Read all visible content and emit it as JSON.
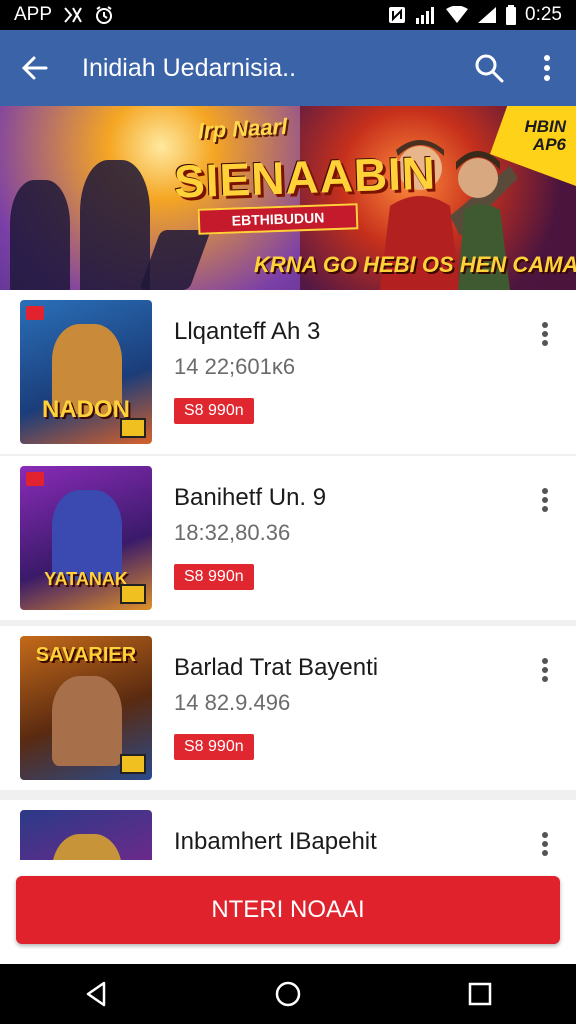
{
  "status_bar": {
    "app_label": "APP",
    "time": "0:25",
    "icons": [
      "network-icon",
      "alarm-icon",
      "nfc-icon",
      "signal-icon",
      "wifi-icon",
      "signal-icon",
      "battery-icon"
    ]
  },
  "app_bar": {
    "title": "Inidiah Uedarnisia..",
    "icons": [
      "back-arrow-icon",
      "search-icon",
      "more-vert-icon"
    ]
  },
  "banner": {
    "top_tag": "Irp Naarl",
    "main_title": "SIENAABIN",
    "ribbon": "EBTHIBUDUN",
    "bottom_line": "KRNA GO HEBI OS HEN CAMAA.",
    "badge_line1": "HBIN",
    "badge_line2": "AP6"
  },
  "list": {
    "items": [
      {
        "title": "Llqanteff Ah 3",
        "subtitle": "14 22;601κ6",
        "price": "S8 990n",
        "thumb_label": "NADON"
      },
      {
        "title": "Banihetf Un. 9",
        "subtitle": "18:32,80.36",
        "price": "S8 990n",
        "thumb_label": "YATANAK"
      },
      {
        "title": "Barlad Trat Bayenti",
        "subtitle": "14 82.9.496",
        "price": "S8 990n",
        "thumb_label": "SAVARIER"
      },
      {
        "title": "Inbamhert IBapehit",
        "subtitle": "",
        "price": "",
        "thumb_label": ""
      }
    ],
    "colors": {
      "price_chip": "#e0262f",
      "thumb_1": "#2a6fb8",
      "thumb_2": "#8a2bb8",
      "thumb_3": "#c46a1a",
      "thumb_4": "#2b3a88"
    }
  },
  "cta": {
    "label": "NTERI NOAAI",
    "color": "#e0222d"
  },
  "nav_bar": {
    "icons": [
      "back-triangle-icon",
      "home-circle-icon",
      "recents-square-icon"
    ]
  },
  "theme": {
    "app_bar": "#3a63a8"
  }
}
